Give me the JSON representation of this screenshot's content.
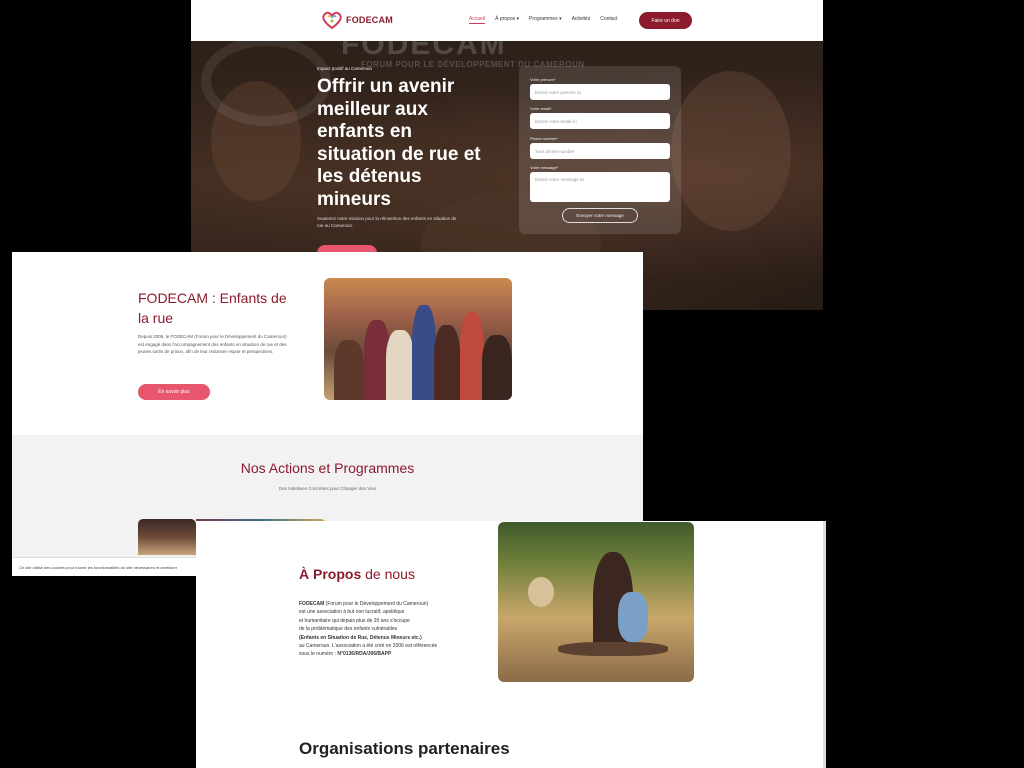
{
  "nav": {
    "logo_text": "FODECAM",
    "links": [
      "Accueil",
      "À propos",
      "Programmes",
      "Activités",
      "Contact"
    ],
    "donate": "Faire un don"
  },
  "hero": {
    "watermark": "FODECAM",
    "watermark_sub": "FORUM POUR LE DÉVELOPPEMENT DU CAMEROUN",
    "kicker": "Impact positif au Cameroun",
    "title": "Offrir un avenir meilleur aux enfants en situation de rue et les détenus mineurs",
    "description": "Soutenez notre mission pour la réinsertion des enfants en situation de rue au Cameroun."
  },
  "form": {
    "first_name_label": "Votre prénom*",
    "first_name_placeholder": "Entrez votre prénom ici",
    "email_label": "Votre email*",
    "email_placeholder": "Entrez votre email ici",
    "phone_label": "Phone number*",
    "phone_placeholder": "Your phone number",
    "message_label": "Votre message*",
    "message_placeholder": "Entrez votre message ici",
    "submit": "Envoyer votre message"
  },
  "enfants": {
    "title": "FODECAM : Enfants de la rue",
    "text": "Depuis 2006, le FODECAM (Forum pour le Développement du Cameroun) est engagé dans l'accompagnement des enfants en situation de rue et des jeunes sortis de prison, afin de leur redonner espoir et perspectives.",
    "button": "En savoir plus"
  },
  "actions": {
    "title": "Nos Actions et Programmes",
    "subtitle": "Des Initiatives Concrètes pour Changer des Vies"
  },
  "cookie": {
    "text": "Ce site utilise des cookies pour fournir les fonctionnalités du site nécessaires et améliorer"
  },
  "apropos": {
    "title_strong": "À Propos",
    "title_rest": " de nous",
    "org": "FODECAM",
    "line1": " (Forum pour le Développement du Cameroun)",
    "line2": "est une association à but non lucratif, apolitique",
    "line3": "et humanitaire qui depuis plus de 20 ans s'occupe",
    "line4": "de la problématique des enfants vulnérables",
    "line5": "(Enfants en Situation de Rue, Détenus Mineurs etc.)",
    "line6": "au Cameroun. L'association a été créé en 2006 est référencée",
    "line7_prefix": "sous le numéro : ",
    "line7_number": "N°0136/RDA/J06/BAPP",
    "partners_title": "Organisations partenaires"
  }
}
